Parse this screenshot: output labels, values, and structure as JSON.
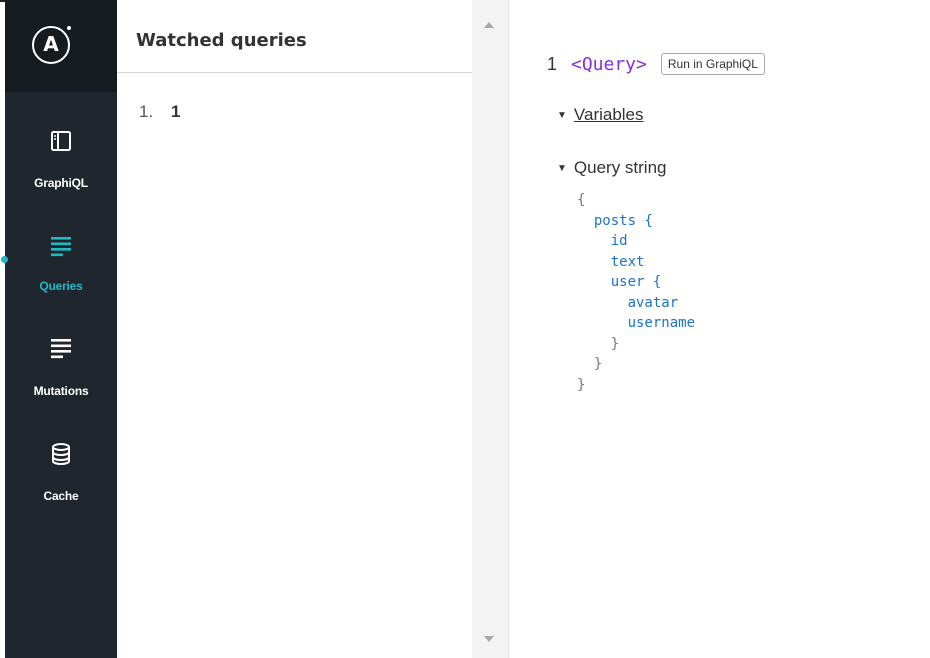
{
  "nav": {
    "logo_letter": "A",
    "items": [
      {
        "label": "GraphiQL",
        "icon": "graphiql-panel-icon",
        "active": false
      },
      {
        "label": "Queries",
        "icon": "queries-list-icon",
        "active": true
      },
      {
        "label": "Mutations",
        "icon": "mutations-list-icon",
        "active": false
      },
      {
        "label": "Cache",
        "icon": "database-icon",
        "active": false
      }
    ],
    "accent_color": "#22b8c6"
  },
  "list": {
    "title": "Watched queries",
    "items": [
      {
        "index": "1.",
        "value": "1"
      }
    ]
  },
  "detail": {
    "query_number": "1",
    "query_name": "<Query>",
    "run_button": "Run in GraphiQL",
    "variables_label": "Variables",
    "query_string_label": "Query string",
    "code_lines": [
      {
        "text": "{",
        "field": false
      },
      {
        "text": "  posts {",
        "field": true
      },
      {
        "text": "    id",
        "field": true
      },
      {
        "text": "    text",
        "field": true
      },
      {
        "text": "    user {",
        "field": true
      },
      {
        "text": "      avatar",
        "field": true
      },
      {
        "text": "      username",
        "field": true
      },
      {
        "text": "    }",
        "field": false
      },
      {
        "text": "  }",
        "field": false
      },
      {
        "text": "}",
        "field": false
      }
    ]
  }
}
